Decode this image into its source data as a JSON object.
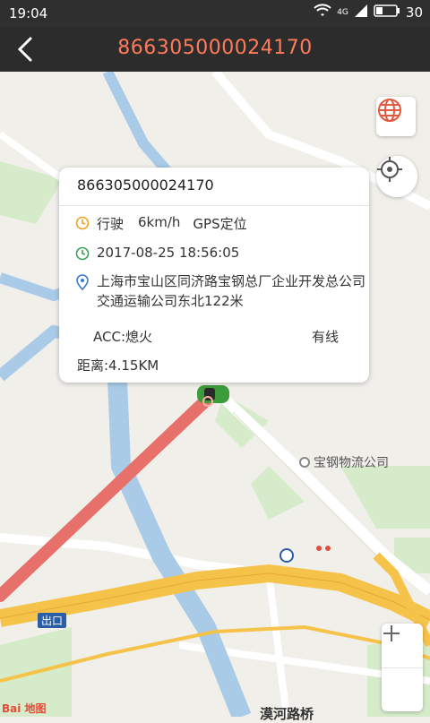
{
  "status": {
    "time": "19:04",
    "network": "4G",
    "battery": "30"
  },
  "header": {
    "title": "866305000024170"
  },
  "popup": {
    "imei": "866305000024170",
    "state": "行驶",
    "speed": "6km/h",
    "locate_mode": "GPS定位",
    "datetime": "2017-08-25 18:56:05",
    "address": "上海市宝山区同济路宝钢总厂企业开发总公司交通运输公司东北122米",
    "acc": "ACC:熄火",
    "connection": "有线",
    "distance": "距离:4.15KM"
  },
  "map": {
    "poi_label": "宝钢物流公司",
    "exit_label": "出口",
    "road_label": "漠河路桥",
    "logo_text": "Bai 地图"
  },
  "colors": {
    "accent": "#ff7b5a",
    "route": "#e8706a",
    "water": "#a9cbe8",
    "highway": "#f5c24a"
  },
  "icons": [
    "back-arrow-icon",
    "globe-icon",
    "locate-icon",
    "zoom-in-icon",
    "zoom-out-icon",
    "clock-icon",
    "time-icon",
    "location-pin-icon",
    "car-icon"
  ]
}
